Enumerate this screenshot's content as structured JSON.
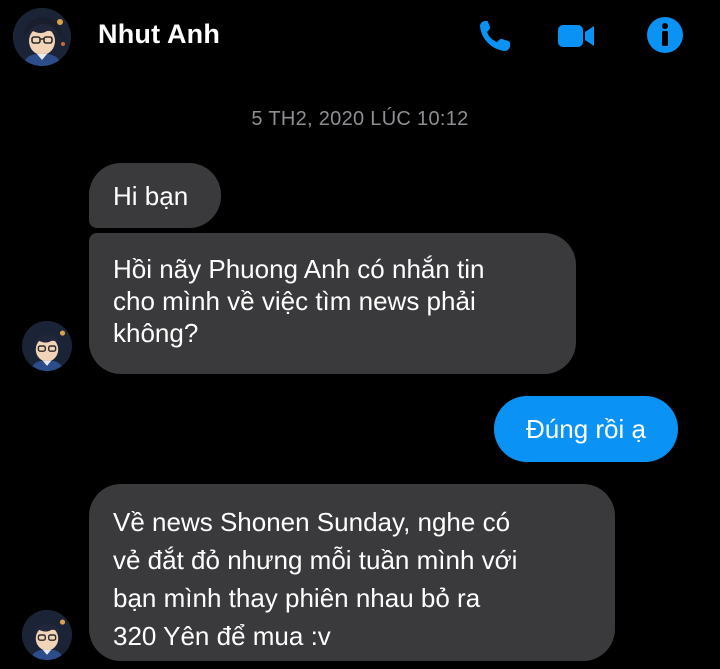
{
  "header": {
    "contact_name": "Nhut Anh",
    "avatar_icon": "profile-avatar",
    "actions": [
      {
        "icon": "phone-icon",
        "label": "call"
      },
      {
        "icon": "video-camera-icon",
        "label": "video call"
      },
      {
        "icon": "info-icon",
        "label": "info"
      }
    ]
  },
  "colors": {
    "accent": "#0a93f5",
    "incoming_bubble": "#3a3a3c",
    "background": "#000000",
    "timestamp": "#8e8e93"
  },
  "conversation": {
    "timestamp": "5 TH2, 2020 LÚC 10:12",
    "messages": [
      {
        "direction": "incoming",
        "lines": [
          "Hi bạn"
        ]
      },
      {
        "direction": "incoming",
        "lines": [
          "Hồi nãy Phuong Anh có nhắn tin",
          "cho mình về việc tìm news phải",
          "không?"
        ]
      },
      {
        "direction": "outgoing",
        "lines": [
          "Đúng rồi ạ"
        ]
      },
      {
        "direction": "incoming",
        "lines": [
          "Về news Shonen Sunday, nghe có",
          "vẻ đắt đỏ nhưng mỗi tuần mình với",
          "bạn mình thay phiên nhau bỏ ra",
          "320 Yên để mua :v"
        ]
      }
    ]
  }
}
